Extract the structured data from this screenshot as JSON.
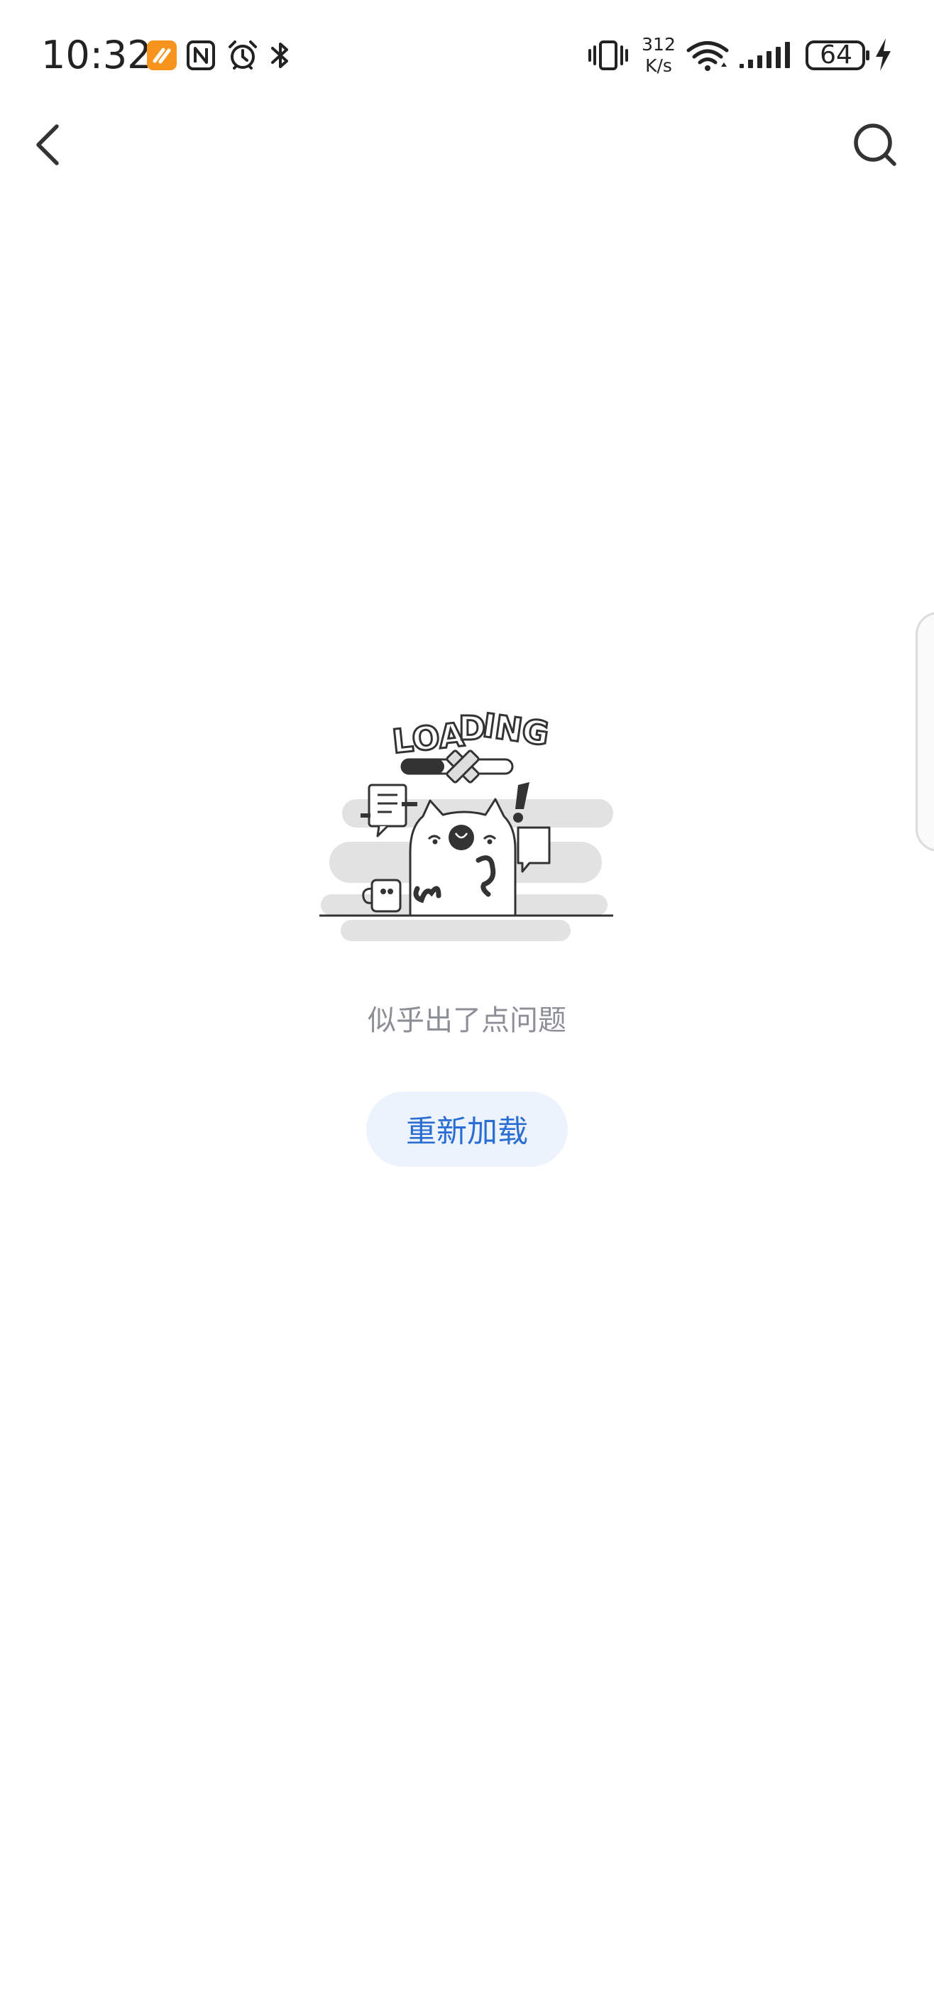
{
  "status_bar": {
    "time": "10:32",
    "net_speed_value": "312",
    "net_speed_unit": "K/s",
    "battery_level": "64",
    "icons": [
      "app-notification-icon",
      "nfc-icon",
      "alarm-icon",
      "bluetooth-icon",
      "vibrate-icon",
      "wifi-icon",
      "signal-icon",
      "battery-icon",
      "charging-icon"
    ],
    "app_icon_color": "#f7941d"
  },
  "nav": {
    "back_icon": "chevron-left-icon",
    "search_icon": "search-icon"
  },
  "error": {
    "illustration_text": "LOADING",
    "message": "似乎出了点问题",
    "reload_label": "重新加载"
  },
  "colors": {
    "message": "#8c8f96",
    "reload_text": "#2a6ed3",
    "reload_background": "#edf3fd"
  }
}
